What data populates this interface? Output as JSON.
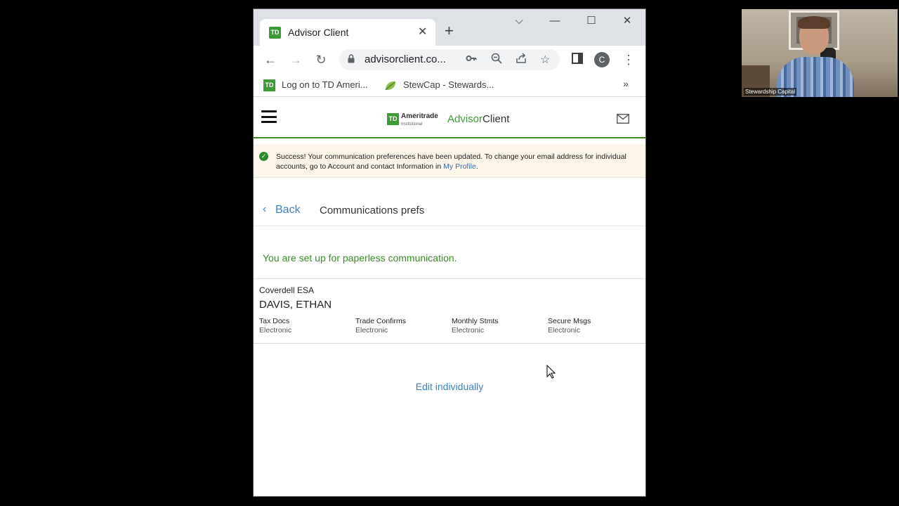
{
  "browser": {
    "tab_title": "Advisor Client",
    "tab_favicon": "TD",
    "url": "advisorclient.co...",
    "profile_initial": "C",
    "bookmarks": [
      {
        "label": "Log on to TD Ameri...",
        "icon": "td-favicon"
      },
      {
        "label": "StewCap - Stewards...",
        "icon": "leaf-favicon"
      }
    ],
    "bookmarks_more": "»"
  },
  "app": {
    "brand_logo_text": "TD",
    "brand_name": "Ameritrade",
    "brand_sub": "Institutional",
    "product_part1": "Advisor",
    "product_part2": "Client"
  },
  "alert": {
    "text": "Success! Your communication preferences have been updated. To change your email address for individual accounts, go to Account and contact Information in ",
    "link": "My Profile",
    "end": "."
  },
  "nav": {
    "back_label": "Back",
    "page_title": "Communications prefs"
  },
  "paperless_message": "You are set up for paperless communication.",
  "account": {
    "type": "Coverdell ESA",
    "name": "DAVIS, ETHAN",
    "prefs": [
      {
        "label": "Tax Docs",
        "value": "Electronic"
      },
      {
        "label": "Trade Confirms",
        "value": "Electronic"
      },
      {
        "label": "Monthly Stmts",
        "value": "Electronic"
      },
      {
        "label": "Secure Msgs",
        "value": "Electronic"
      }
    ]
  },
  "edit_link": "Edit individually",
  "video": {
    "participant_label": "Stewardship Capital"
  },
  "colors": {
    "td_green": "#3c9b35",
    "link_blue": "#3b82c4",
    "success_green": "#3c8a2a",
    "alert_bg": "#fbf5ea"
  }
}
